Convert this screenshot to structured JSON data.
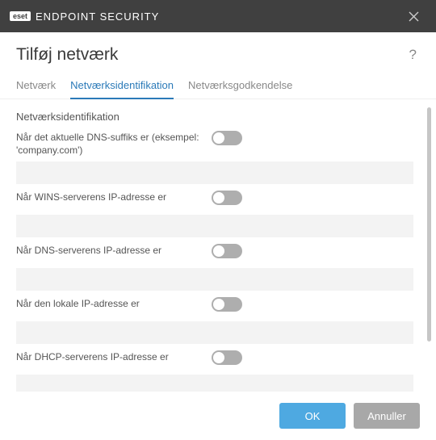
{
  "titlebar": {
    "brand_logo": "eset",
    "brand_text": "ENDPOINT SECURITY"
  },
  "header": {
    "title": "Tilføj netværk",
    "help": "?"
  },
  "tabs": [
    {
      "label": "Netværk",
      "active": false
    },
    {
      "label": "Netværksidentifikation",
      "active": true
    },
    {
      "label": "Netværksgodkendelse",
      "active": false
    }
  ],
  "section_title": "Netværksidentifikation",
  "rows": [
    {
      "label": "Når det aktuelle DNS-suffiks er (eksempel: 'company.com')",
      "enabled": false,
      "value": ""
    },
    {
      "label": "Når WINS-serverens IP-adresse er",
      "enabled": false,
      "value": ""
    },
    {
      "label": "Når DNS-serverens IP-adresse er",
      "enabled": false,
      "value": ""
    },
    {
      "label": "Når den lokale IP-adresse er",
      "enabled": false,
      "value": ""
    },
    {
      "label": "Når DHCP-serverens IP-adresse er",
      "enabled": false,
      "value": ""
    }
  ],
  "footer": {
    "ok": "OK",
    "cancel": "Annuller"
  }
}
